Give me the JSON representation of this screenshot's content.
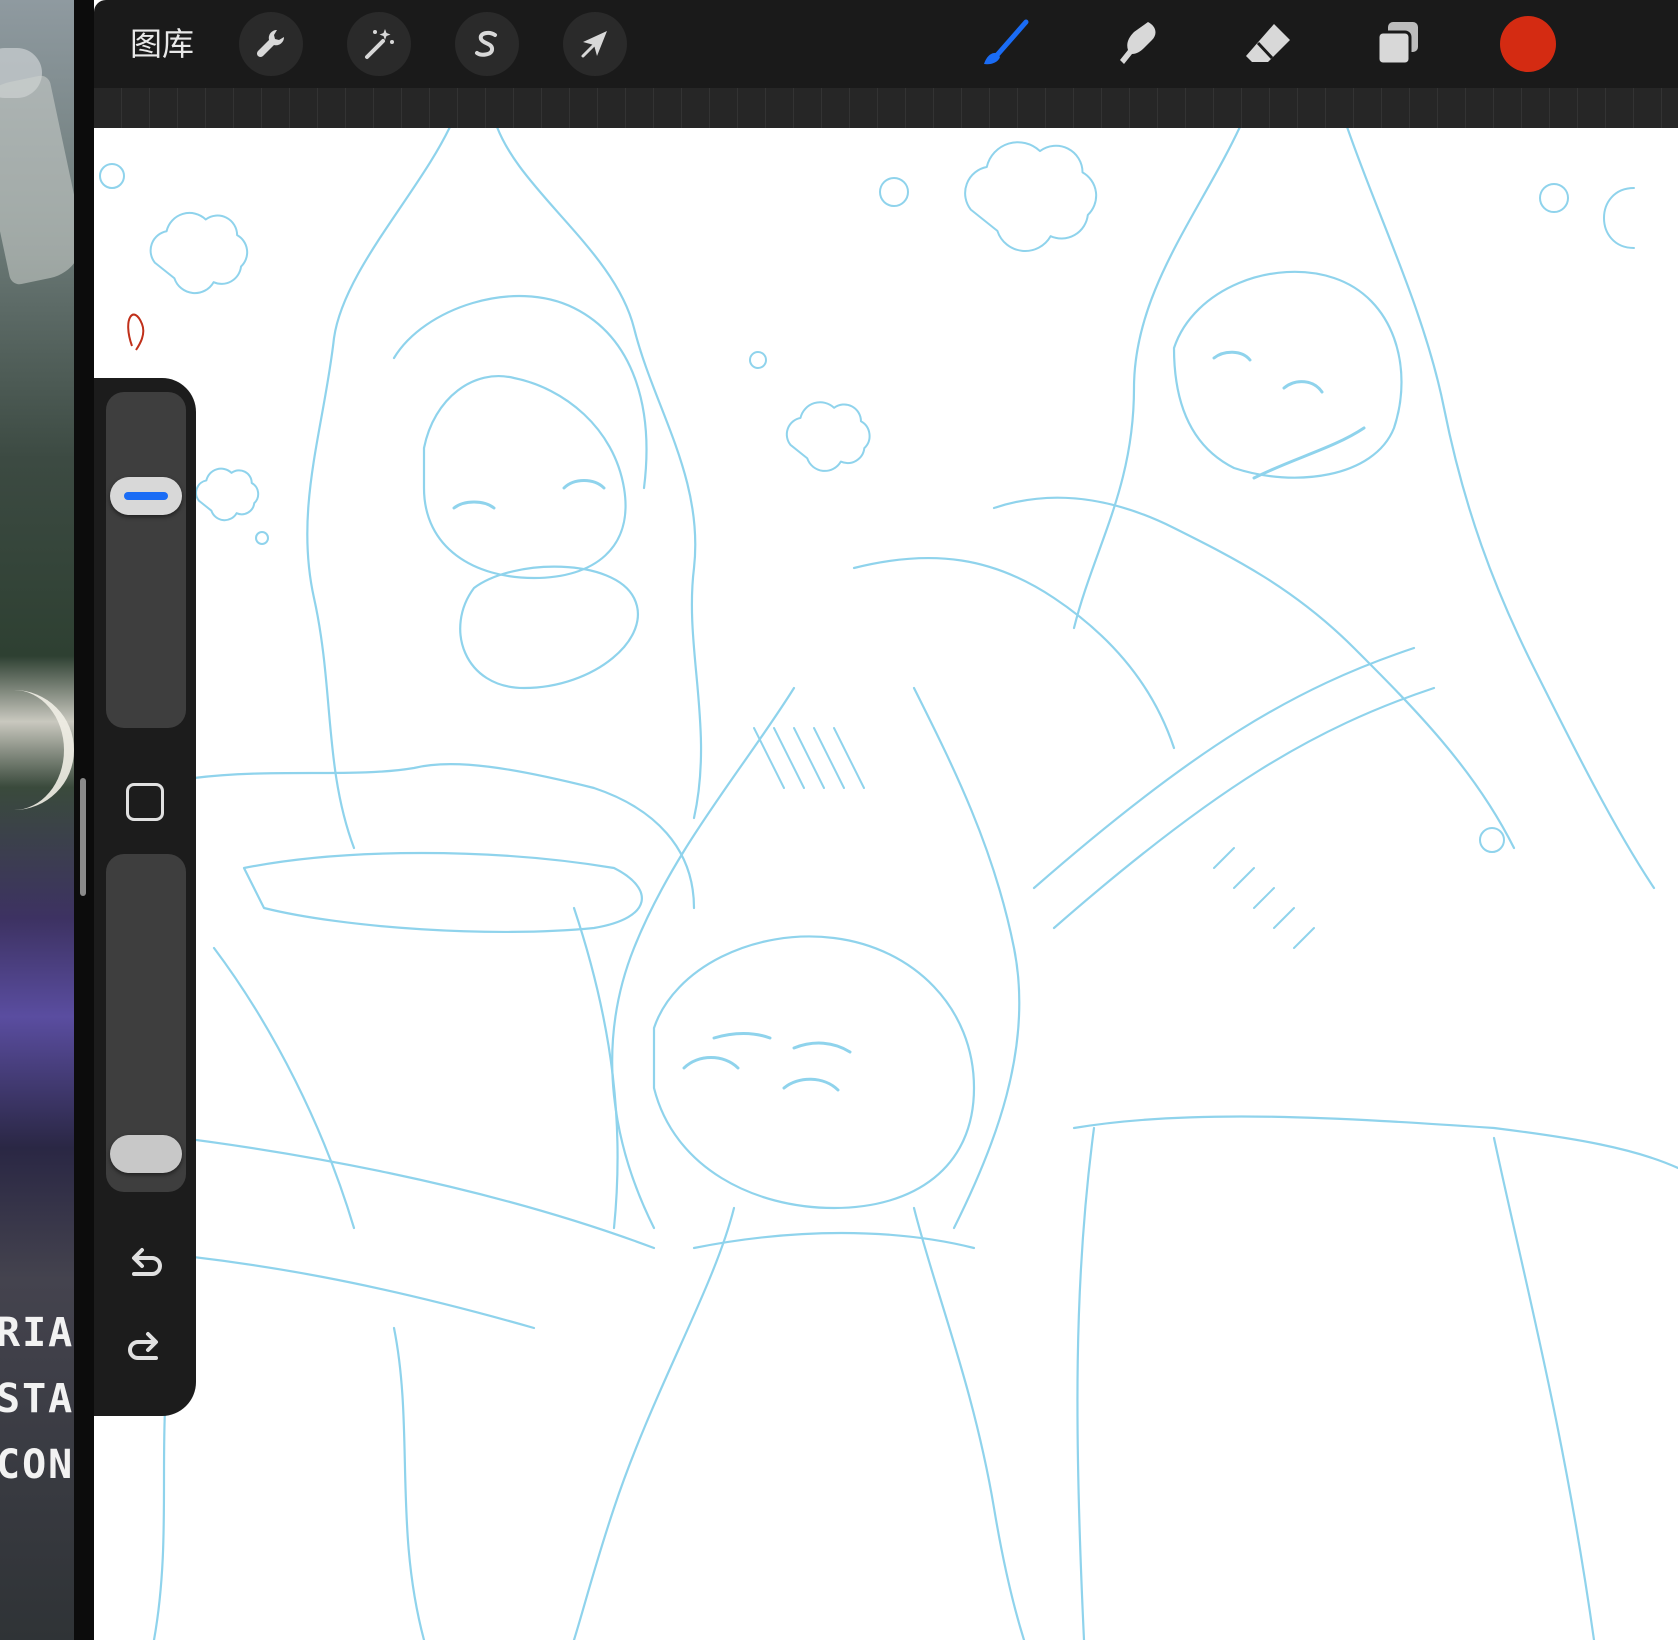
{
  "toolbar": {
    "gallery_label": "图库",
    "left_tools": [
      "wrench-icon",
      "magic-wand-icon",
      "selection-s-icon",
      "transform-arrow-icon"
    ],
    "right_tools": [
      "brush-icon",
      "smudge-icon",
      "eraser-icon",
      "layers-icon"
    ],
    "active_tool": "brush-icon",
    "current_color": "#d42b12",
    "active_accent": "#1a6cf5"
  },
  "sidebar": {
    "brush_size": 0.72,
    "opacity": 0.05,
    "modify_icon": "square-icon",
    "undo_icon": "undo-arrow-icon",
    "redo_icon": "redo-arrow-icon"
  },
  "side_app": {
    "poster_lines": [
      "RIA",
      "STA",
      "CON"
    ]
  },
  "canvas": {
    "sketch_color": "#8fd3ec",
    "accent_stroke_color": "#c0301a"
  }
}
